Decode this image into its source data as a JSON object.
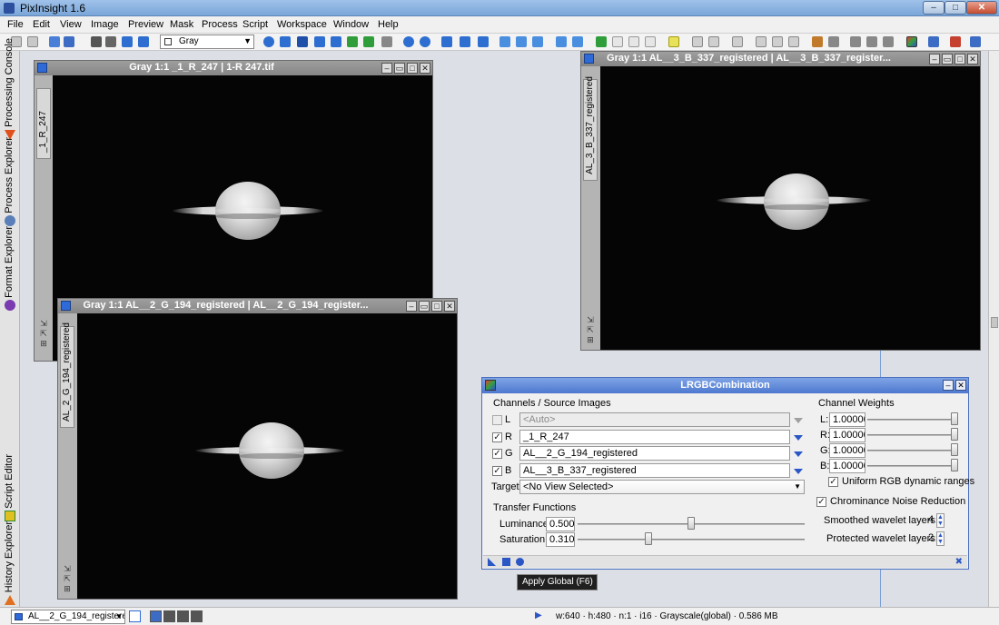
{
  "app": {
    "title": "PixInsight 1.6",
    "window_controls": [
      "–",
      "□",
      "✕"
    ]
  },
  "menu": [
    "File",
    "Edit",
    "View",
    "Image",
    "Preview",
    "Mask",
    "Process",
    "Script",
    "Workspace",
    "Window",
    "Help"
  ],
  "toolbar": {
    "colorspace_value": "Gray"
  },
  "side_panel": {
    "tabs": [
      "Processing Console",
      "Process Explorer",
      "Format Explorer",
      "Script Editor",
      "History Explorer"
    ]
  },
  "image_windows": [
    {
      "title": "Gray 1:1 _1_R_247 | 1-R 247.tif",
      "view_id": "_1_R_247"
    },
    {
      "title": "Gray 1:1 AL__3_B_337_registered | AL__3_B_337_register...",
      "view_id": "AL_3_B_337_registered"
    },
    {
      "title": "Gray 1:1 AL__2_G_194_registered | AL__2_G_194_register...",
      "view_id": "AL_2_G_194_registered"
    }
  ],
  "lrgb": {
    "title": "LRGBCombination",
    "channels_header": "Channels / Source Images",
    "channels": [
      {
        "label": "L",
        "checked": false,
        "source": "<Auto>"
      },
      {
        "label": "R",
        "checked": true,
        "source": "_1_R_247"
      },
      {
        "label": "G",
        "checked": true,
        "source": "AL__2_G_194_registered"
      },
      {
        "label": "B",
        "checked": true,
        "source": "AL__3_B_337_registered"
      }
    ],
    "target_label": "Target:",
    "target_value": "<No View Selected>",
    "transfer_header": "Transfer Functions",
    "luminance_label": "Luminance:",
    "luminance_value": "0.500",
    "luminance": 0.5,
    "saturation_label": "Saturation:",
    "saturation_value": "0.310",
    "saturation": 0.31,
    "weights_header": "Channel Weights",
    "weights": [
      {
        "label": "L:",
        "value": "1.00000"
      },
      {
        "label": "R:",
        "value": "1.00000"
      },
      {
        "label": "G:",
        "value": "1.00000"
      },
      {
        "label": "B:",
        "value": "1.00000"
      }
    ],
    "uniform_label": "Uniform RGB dynamic ranges",
    "uniform_checked": true,
    "chroma_label": "Chrominance Noise Reduction",
    "chroma_checked": true,
    "smoothed_label": "Smoothed wavelet layers:",
    "smoothed_value": "4",
    "protected_label": "Protected wavelet layers:",
    "protected_value": "2"
  },
  "tooltip": "Apply Global (F6)",
  "status": {
    "view_selector": "AL__2_G_194_registered",
    "info": "w:640 · h:480 · n:1 · i16 · Grayscale(global) · 0.586 MB"
  },
  "colors": {
    "title_blue": "#7aa6d8",
    "dialog_title": "#4d78cf",
    "accent_arrow": "#2b56c6"
  }
}
